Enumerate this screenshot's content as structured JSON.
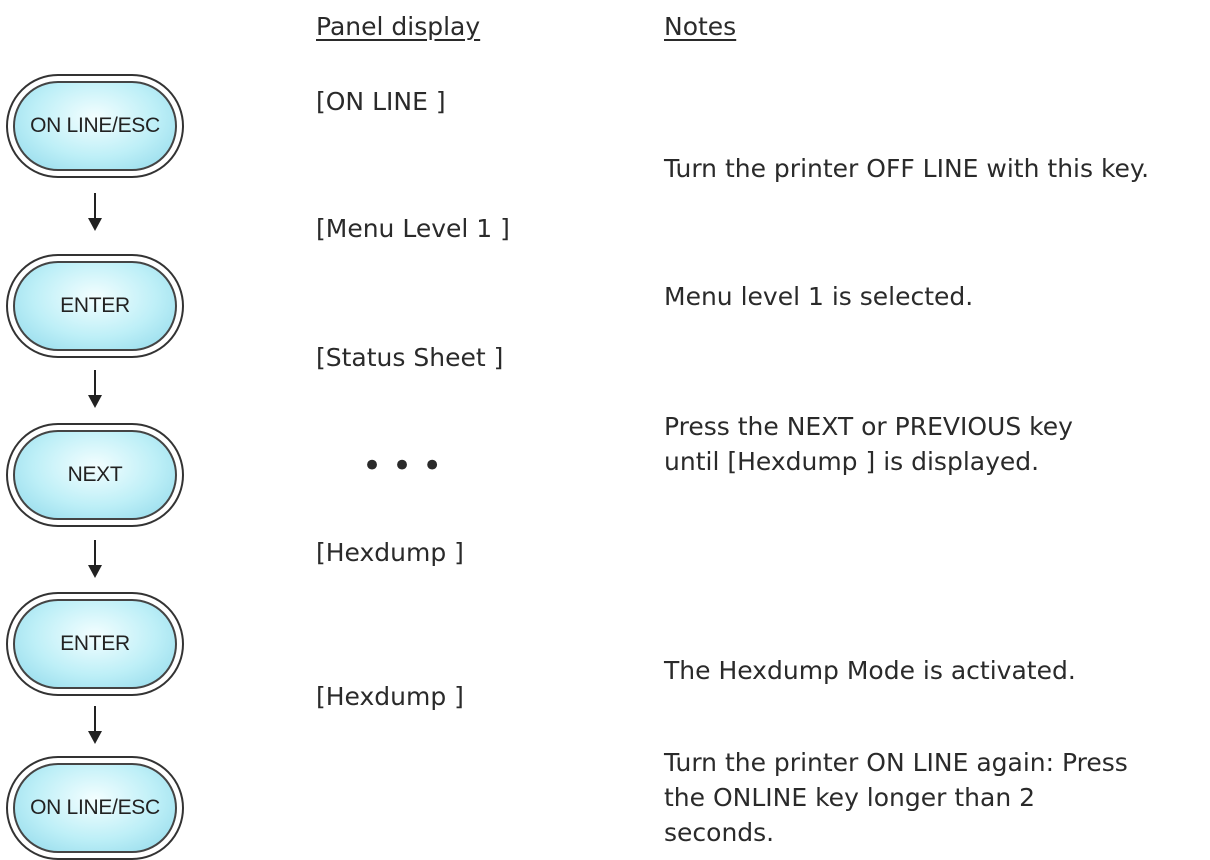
{
  "headers": {
    "panel": "Panel display",
    "notes": "Notes"
  },
  "keys": [
    "ON LINE/ESC",
    "ENTER",
    "NEXT",
    "ENTER",
    "ON LINE/ESC"
  ],
  "panel": {
    "p1": "[ON LINE ]",
    "p2": "[Menu Level 1 ]",
    "p3": "[Status Sheet ]",
    "dots": "•••",
    "p4": "[Hexdump ]",
    "p5": "[Hexdump ]"
  },
  "notes": {
    "n1": "Turn the printer OFF LINE with this key.",
    "n2": "Menu level 1 is selected.",
    "n3": "Press the NEXT or PREVIOUS key until [Hexdump ] is displayed.",
    "n4": "The Hexdump Mode is activated.",
    "n5": "Turn the printer ON LINE again: Press the ONLINE key longer than 2 seconds."
  }
}
